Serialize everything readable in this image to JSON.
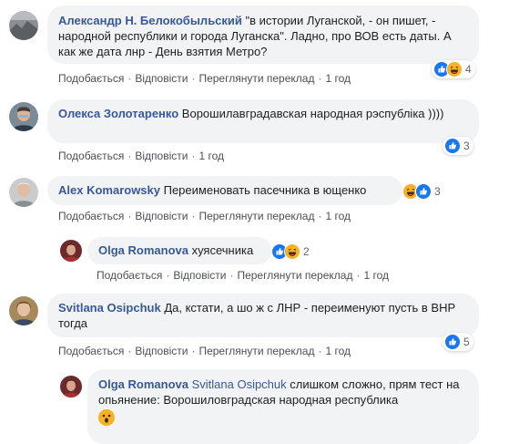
{
  "comments": [
    {
      "author": "Александр Н. Белокобыльский",
      "text": " \"в истории Луганской, - он пишет, - народной республики и города Луганска\". Ладно, про ВОВ есть даты. А как же дата лнр - День взятия Метро?",
      "actions": {
        "like": "Подобається",
        "reply": "Відповісти",
        "translate": "Переглянути переклад",
        "time": "1 год"
      },
      "reactions": {
        "count": "4",
        "icons": [
          "like-icon",
          "haha-icon"
        ]
      }
    },
    {
      "author": "Олекса Золотаренко",
      "text": " Ворошилавградавская народная рэспублiка ))))",
      "actions": {
        "like": "Подобається",
        "reply": "Відповісти",
        "time": "1 год"
      },
      "reactions": {
        "count": "3",
        "icons": [
          "like-icon"
        ]
      }
    },
    {
      "author": "Alex Komarowsky",
      "text": " Переименовать пасечника в ющенко",
      "actions": {
        "like": "Подобається",
        "reply": "Відповісти",
        "translate": "Переглянути переклад",
        "time": "1 год"
      },
      "reactions": {
        "count": "3",
        "icons": [
          "haha-icon",
          "like-icon"
        ]
      }
    },
    {
      "author": "Olga Romanova",
      "text": " хуясечника",
      "actions": {
        "like": "Подобається",
        "reply": "Відповісти",
        "translate": "Переглянути переклад",
        "time": "1 год"
      },
      "reactions": {
        "count": "2",
        "icons": [
          "like-icon",
          "haha-icon"
        ]
      }
    },
    {
      "author": "Svitlana Osipchuk",
      "text": " Да, кстати, а шо ж с ЛНР - переименуют пусть в ВНР тогда",
      "actions": {
        "like": "Подобається",
        "reply": "Відповісти",
        "translate": "Переглянути переклад",
        "time": "1 год"
      },
      "reactions": {
        "count": "5",
        "icons": [
          "like-icon"
        ]
      }
    },
    {
      "author": "Olga Romanova",
      "mention": "Svitlana Osipchuk",
      "text": " слишком сложно, прям тест на опьянение: Ворошиловградская народная республика",
      "reactions": {
        "icons": [
          "wow-icon"
        ]
      }
    }
  ],
  "colors": {
    "link": "#385898",
    "bubble": "#f2f3f5",
    "meta": "#606770",
    "like": "#1877f2",
    "haha": "#f7b125"
  }
}
